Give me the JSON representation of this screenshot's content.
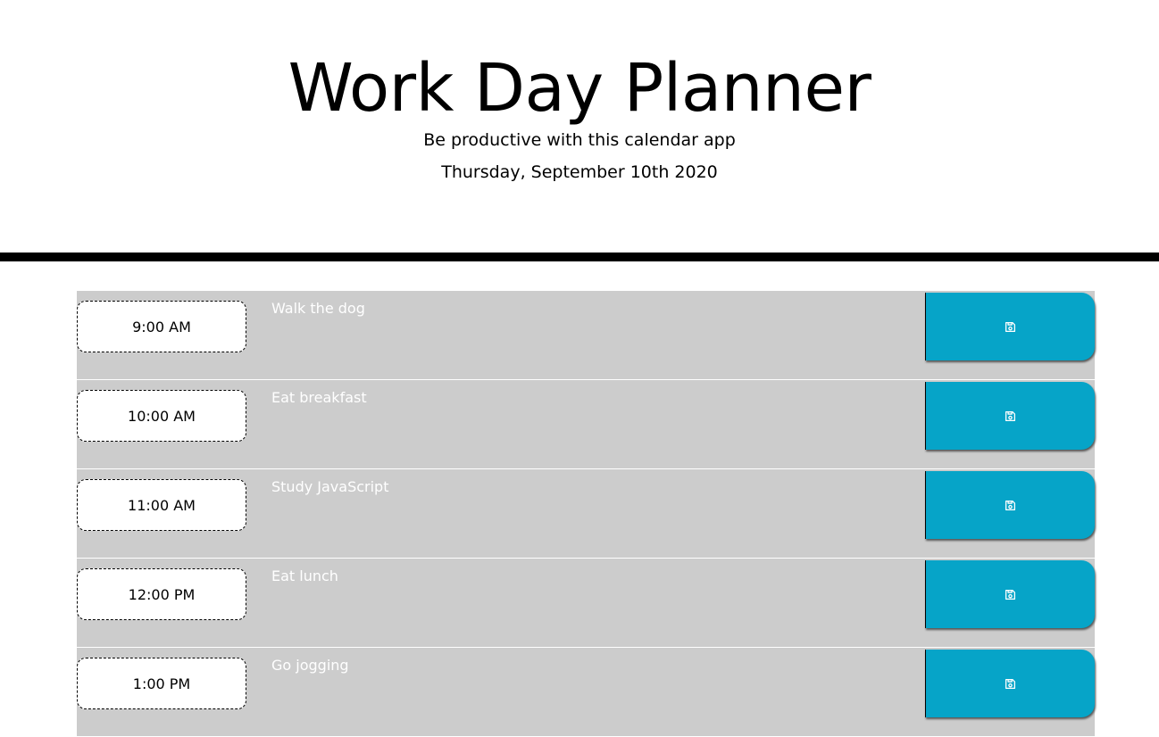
{
  "header": {
    "title": "Work Day Planner",
    "lead": "Be productive with this calendar app",
    "current_day": "Thursday, September 10th 2020"
  },
  "colors": {
    "row_background": "#cccccc",
    "save_button": "#06a4c8",
    "divider": "#000000",
    "description_text": "#ffffff"
  },
  "time_blocks": [
    {
      "hour": "9:00 AM",
      "description": "Walk the dog",
      "save_icon": "save-icon"
    },
    {
      "hour": "10:00 AM",
      "description": "Eat breakfast",
      "save_icon": "save-icon"
    },
    {
      "hour": "11:00 AM",
      "description": "Study JavaScript",
      "save_icon": "save-icon"
    },
    {
      "hour": "12:00 PM",
      "description": "Eat lunch",
      "save_icon": "save-icon"
    },
    {
      "hour": "1:00 PM",
      "description": "Go jogging",
      "save_icon": "save-icon"
    }
  ]
}
